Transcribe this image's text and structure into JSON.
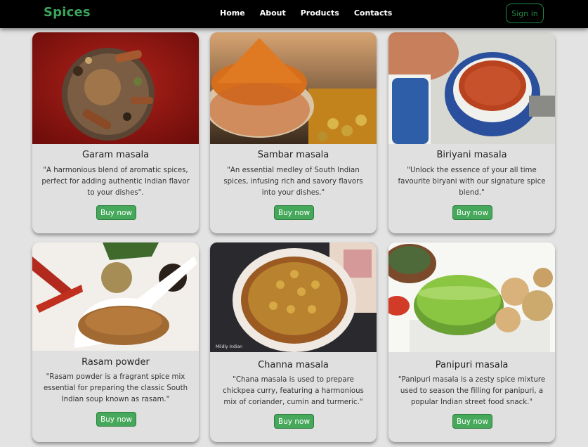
{
  "nav": {
    "brand": "Spices",
    "links": [
      "Home",
      "About",
      "Products",
      "Contacts"
    ],
    "signin": "Sign in"
  },
  "products": [
    {
      "title": "Garam masala",
      "desc": "\"A harmonious blend of aromatic spices, perfect for adding authentic Indian flavor to your dishes\".",
      "button": "Buy now"
    },
    {
      "title": "Sambar masala",
      "desc": "\"An essential medley of South Indian spices, infusing rich and savory flavors into your dishes.\"",
      "button": "Buy now"
    },
    {
      "title": "Biriyani masala",
      "desc": "\"Unlock the essence of your all time favourite biryani with our signature spice blend.\"",
      "button": "Buy now"
    },
    {
      "title": "Rasam powder",
      "desc": "\"Rasam powder is a fragrant spice mix essential for preparing the classic South Indian soup known as rasam.\"",
      "button": "Buy now"
    },
    {
      "title": "Channa masala",
      "desc": "\"Chana masala is used to prepare chickpea curry, featuring a harmonious mix of coriander, cumin and turmeric.\"",
      "button": "Buy now"
    },
    {
      "title": "Panipuri masala",
      "desc": "\"Panipuri masala is a zesty spice mixture used to season the filling for panipuri, a popular Indian street food snack.\"",
      "button": "Buy now"
    }
  ],
  "photo_watermark": "Mildly Indian"
}
